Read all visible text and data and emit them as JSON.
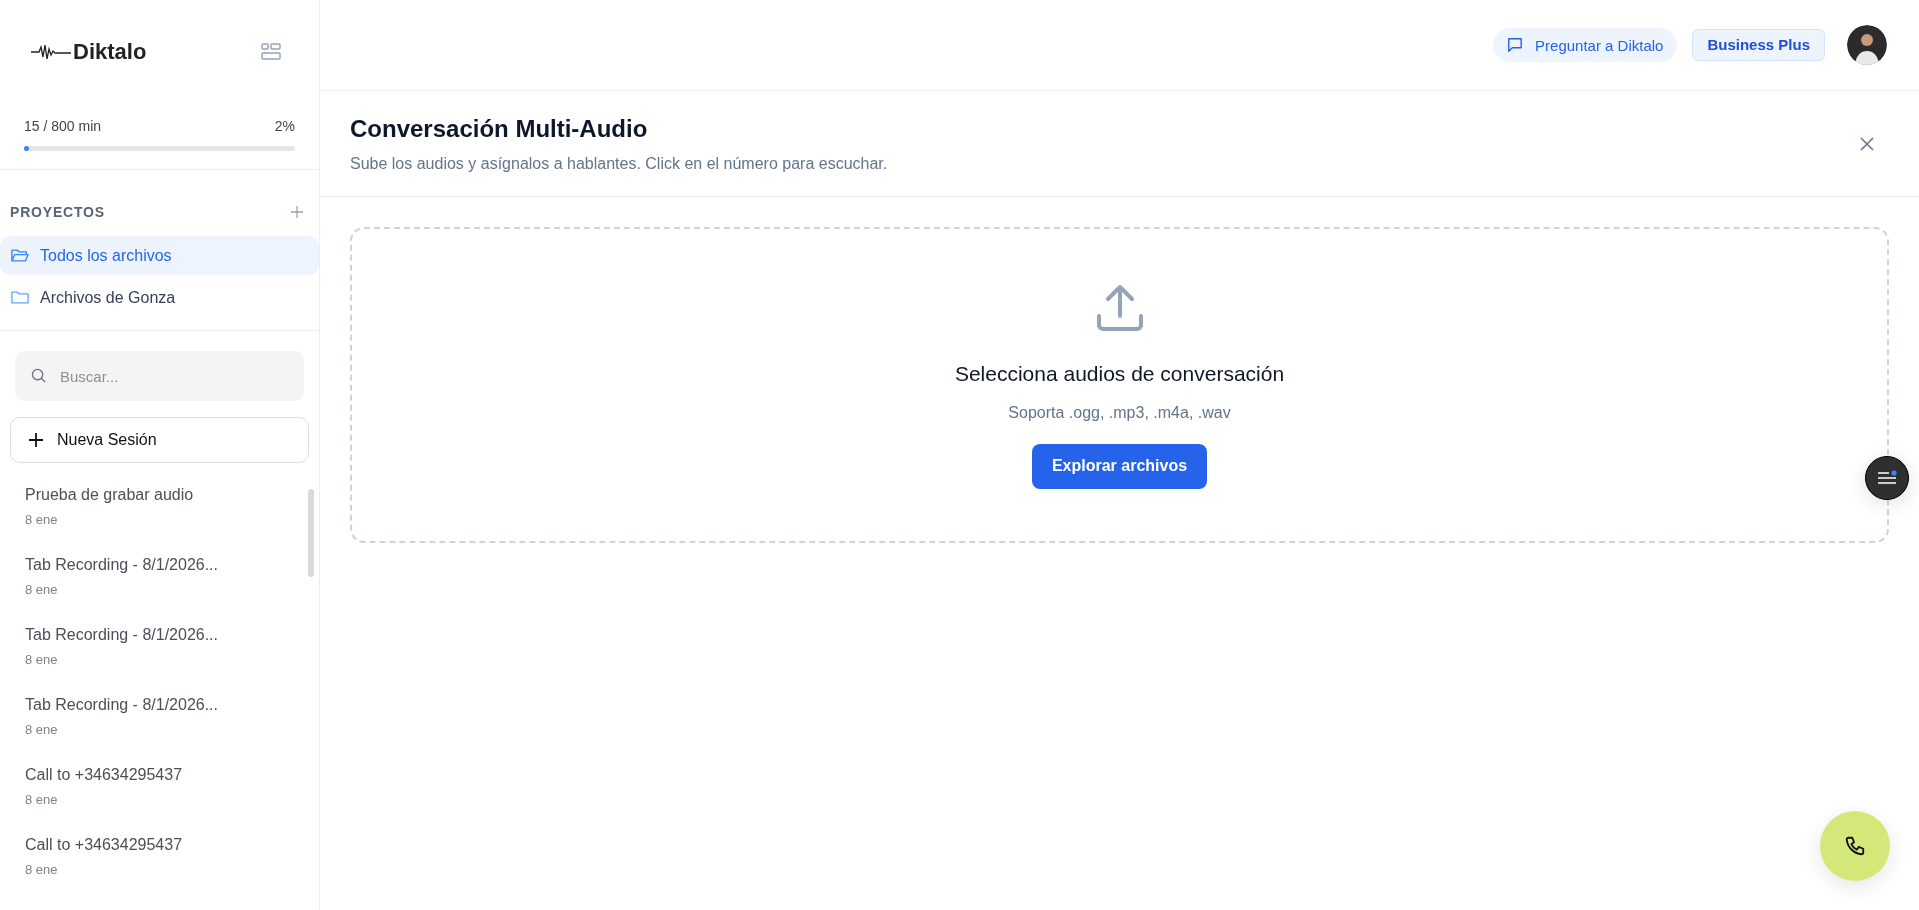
{
  "sidebar": {
    "logo": "Diktalo",
    "usage": {
      "label": "15 / 800 min",
      "percent": "2%",
      "level": 0.02
    },
    "projects": {
      "title": "PROYECTOS",
      "items": [
        {
          "label": "Todos los archivos",
          "selected": true
        },
        {
          "label": "Archivos de Gonza",
          "selected": false
        }
      ]
    },
    "search": {
      "placeholder": "Buscar..."
    },
    "new_session": "Nueva Sesión",
    "sessions": [
      {
        "title": "Prueba de grabar audio",
        "date": "8 ene"
      },
      {
        "title": "Tab Recording - 8/1/2026...",
        "date": "8 ene"
      },
      {
        "title": "Tab Recording - 8/1/2026...",
        "date": "8 ene"
      },
      {
        "title": "Tab Recording - 8/1/2026...",
        "date": "8 ene"
      },
      {
        "title": "Call to +34634295437",
        "date": "8 ene"
      },
      {
        "title": "Call to +34634295437",
        "date": "8 ene"
      }
    ]
  },
  "header": {
    "ask_button": "Preguntar a Diktalo",
    "plan_badge": "Business Plus"
  },
  "panel": {
    "title": "Conversación Multi-Audio",
    "subtitle": "Sube los audios y asígnalos a hablantes. Click en el número para escuchar.",
    "dropzone": {
      "heading": "Selecciona audios de conversación",
      "formats": "Soporta .ogg, .mp3, .m4a, .wav",
      "button": "Explorar archivos"
    }
  },
  "floating_menu": {
    "notification": true
  }
}
